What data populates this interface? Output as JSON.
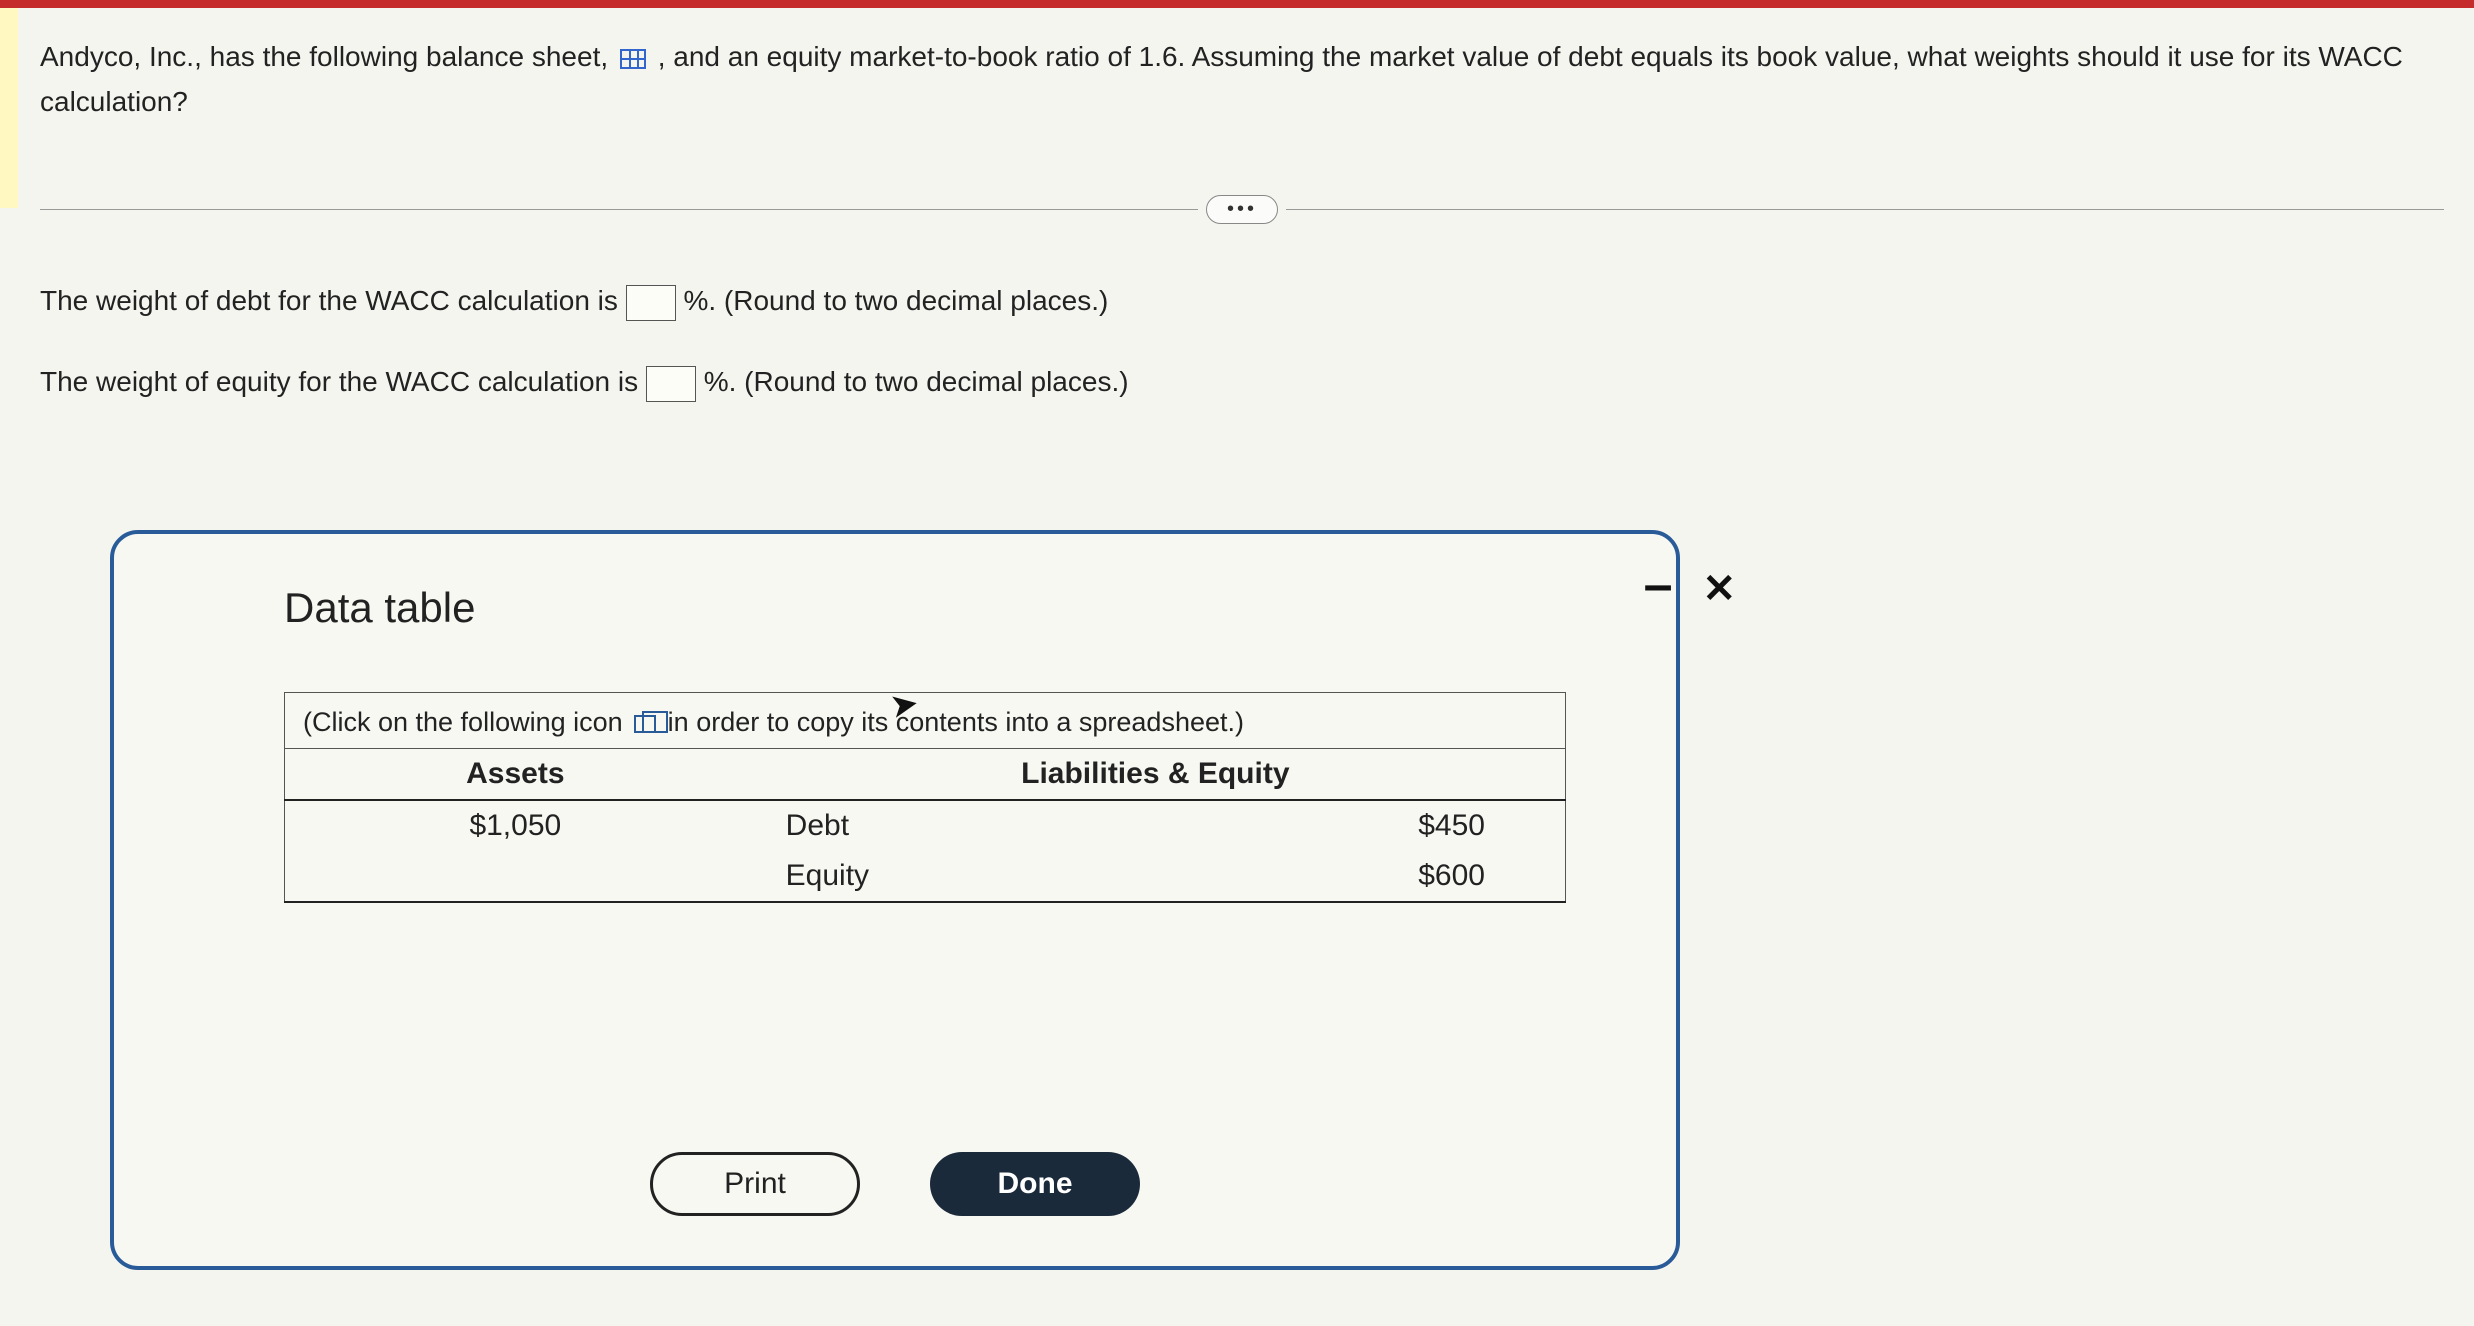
{
  "question": {
    "part1": "Andyco, Inc., has the following balance sheet,",
    "part2": ", and an equity market-to-book ratio of 1.6. Assuming the market value of debt equals its book value, what weights should it use for its WACC calculation?"
  },
  "more_label": "•••",
  "answers": {
    "debt_prefix": "The weight of debt for the WACC calculation is ",
    "debt_suffix": "%. (Round to two decimal places.)",
    "equity_prefix": "The weight of equity for the WACC calculation is ",
    "equity_suffix": "%. (Round to two decimal places.)",
    "debt_value": "",
    "equity_value": ""
  },
  "modal": {
    "title": "Data table",
    "copy_note_pre": "(Click on the following icon ",
    "copy_note_post": " in order to copy its contents into a spreadsheet.)",
    "headers": {
      "assets": "Assets",
      "liab": "Liabilities & Equity"
    },
    "rows": {
      "assets_total": "$1,050",
      "debt_label": "Debt",
      "debt_val": "$450",
      "equity_label": "Equity",
      "equity_val": "$600"
    },
    "buttons": {
      "print": "Print",
      "done": "Done"
    }
  },
  "chart_data": {
    "type": "table",
    "title": "Balance Sheet",
    "assets_total": 1050,
    "liabilities_equity": [
      {
        "label": "Debt",
        "value": 450
      },
      {
        "label": "Equity",
        "value": 600
      }
    ],
    "equity_market_to_book_ratio": 1.6
  }
}
